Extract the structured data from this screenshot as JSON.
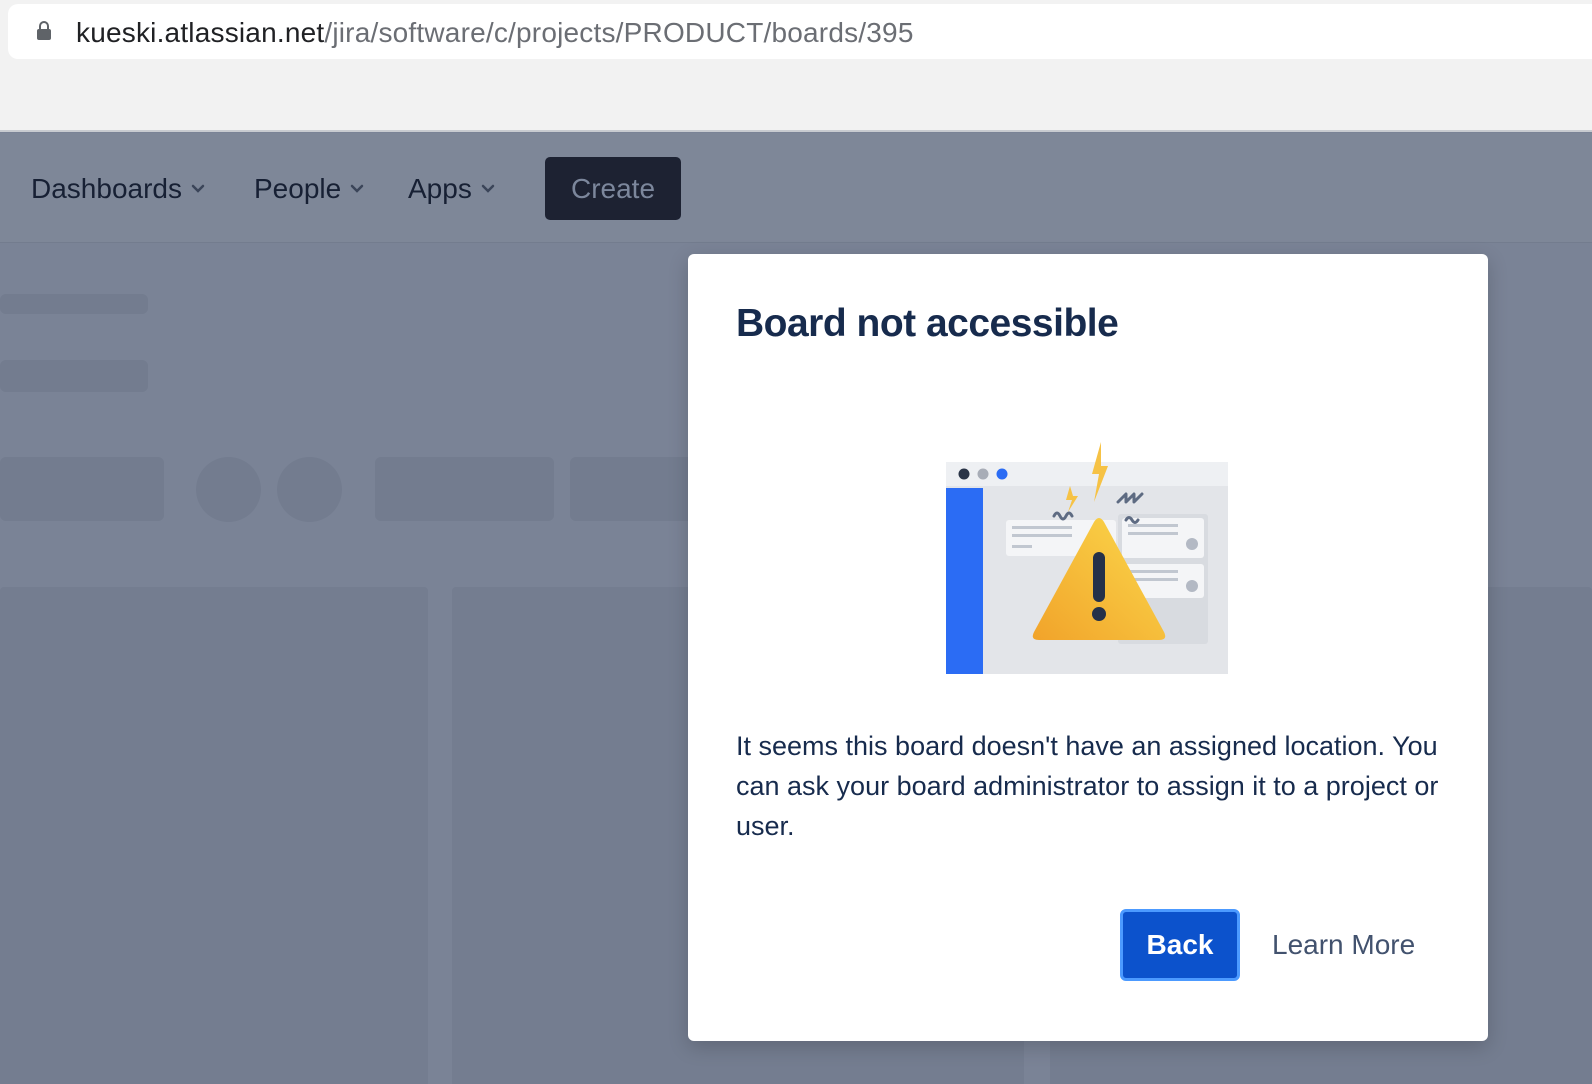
{
  "browser": {
    "url_host": "kueski.atlassian.net",
    "url_path": "/jira/software/c/projects/PRODUCT/boards/395",
    "lock_icon": "lock-icon"
  },
  "nav": {
    "items": [
      {
        "label": "Dashboards",
        "icon": "chevron-down-icon"
      },
      {
        "label": "People",
        "icon": "chevron-down-icon"
      },
      {
        "label": "Apps",
        "icon": "chevron-down-icon"
      }
    ],
    "create_label": "Create"
  },
  "modal": {
    "title": "Board not accessible",
    "illustration": "warning-board-illustration",
    "body": "It seems this board doesn't have an assigned location. You can ask your board administrator to assign it to a project or user.",
    "back_label": "Back",
    "learn_more_label": "Learn More"
  },
  "colors": {
    "overlay": "#7a8396",
    "primary": "#0c52cc",
    "focus_ring": "#4c9aff",
    "title": "#172b4d",
    "warning_yellow": "#f8c93a",
    "sidebar_blue": "#2b6cf4"
  }
}
